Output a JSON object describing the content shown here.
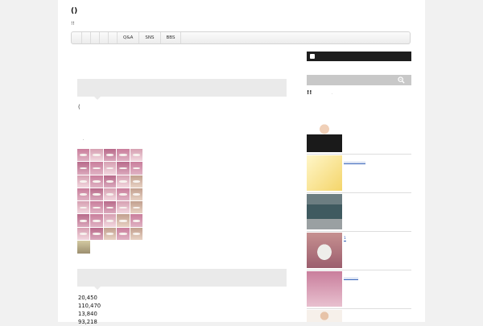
{
  "site": {
    "title": "()",
    "tagline": "!!"
  },
  "nav": {
    "items": [
      "Q&A",
      "SNS",
      "BBS"
    ]
  },
  "main": {
    "paren": "(",
    "dot": ".",
    "stats": [
      "20,450",
      "110,470",
      "13,840",
      "93,218"
    ]
  },
  "sidebar": {
    "heading": "!!",
    "heading_dot": ".",
    "items": [
      {
        "link": ""
      },
      {
        "link": "____________"
      },
      {
        "link": ""
      },
      {
        "link": "1"
      },
      {
        "link": "________"
      },
      {
        "link": ""
      }
    ]
  },
  "icons": {
    "rss": "rss-icon",
    "search": "search-icon"
  },
  "colors": {
    "dark_bar": "#1e1e1e",
    "search_bar": "#c8c8c8",
    "link": "#2a5ab5"
  }
}
